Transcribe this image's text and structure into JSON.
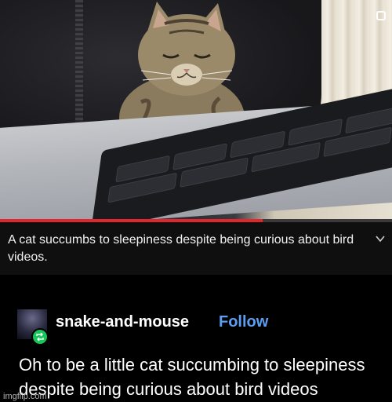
{
  "video": {
    "progress_percent": 67,
    "caption": "A cat succumbs to sleepiness despite being curious about bird videos."
  },
  "post": {
    "username": "snake-and-mouse",
    "follow_label": "Follow",
    "text": "Oh to be a little cat succumbing to sleepiness despite being curious about bird videos"
  },
  "watermark": "imgflip.com",
  "colors": {
    "progress": "#e2262e",
    "follow": "#5b9ef2",
    "reblog_badge": "#17c65a"
  },
  "icons": [
    "instagram-icon",
    "chevron-down-icon",
    "reblog-icon"
  ]
}
